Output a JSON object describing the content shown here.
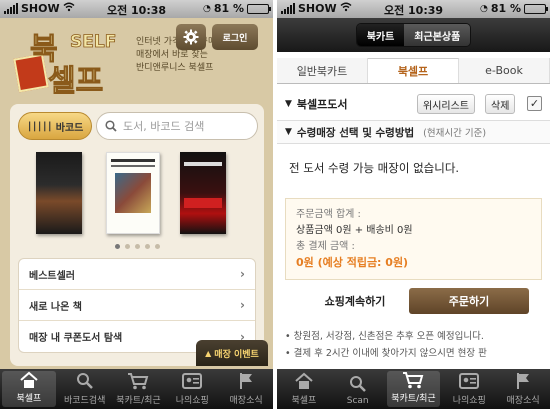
{
  "left": {
    "status": {
      "carrier": "SHOW",
      "time": "오전 10:38",
      "battery": "81 %",
      "battery_level": 0.81
    },
    "logo": {
      "title_1": "북",
      "title_2": "SELF",
      "title_3": "셀프",
      "badge": "book"
    },
    "intro_lines": [
      "인터넷 가격으로 구매하고",
      "매장에서 바로 찾는",
      "반디앤루니스 북셀프"
    ],
    "header": {
      "settings_icon": "gear-icon",
      "login_label": "로그인"
    },
    "barcode_label": "바코드",
    "search": {
      "placeholder": "도서, 바코드 검색"
    },
    "carousel": {
      "page_count": 5,
      "active_index": 0
    },
    "menu": [
      {
        "label": "베스트셀러"
      },
      {
        "label": "새로 나온 책"
      },
      {
        "label": "매장 내 쿠폰도서 탐색"
      }
    ],
    "event_label": "매장 이벤트",
    "tabs": [
      {
        "label": "북셀프",
        "icon": "home-icon",
        "active": true
      },
      {
        "label": "바코드검색",
        "icon": "search-icon",
        "active": false
      },
      {
        "label": "북카트/최근",
        "icon": "cart-icon",
        "active": false
      },
      {
        "label": "나의쇼핑",
        "icon": "id-card-icon",
        "active": false
      },
      {
        "label": "매장소식",
        "icon": "flag-icon",
        "active": false
      }
    ]
  },
  "right": {
    "status": {
      "carrier": "SHOW",
      "time": "오전 10:39",
      "battery": "81 %",
      "battery_level": 0.81
    },
    "segment": [
      {
        "label": "북카트",
        "active": true
      },
      {
        "label": "최근본상품",
        "active": false
      }
    ],
    "top_tabs": [
      {
        "label": "일반북카트",
        "active": false
      },
      {
        "label": "북셀프",
        "active": true
      },
      {
        "label": "e-Book",
        "active": false
      }
    ],
    "shelf": {
      "label": "북셀프도서",
      "wishlist_label": "위시리스트",
      "delete_label": "삭제",
      "check": "✓"
    },
    "pickup": {
      "label": "수령매장 선택 및 수령방법",
      "sub": "(현재시간 기준)"
    },
    "no_store_msg": "전 도서 수령 가능 매장이 없습니다.",
    "order": {
      "total_label": "주문금액 합계 :",
      "total_detail": "상품금액 0원 + 배송비 0원",
      "pay_label": "총 결제 금액 :",
      "pay_amount": "0원 (예상 적립금: 0원)"
    },
    "continue_label": "쇼핑계속하기",
    "order_button": "주문하기",
    "notes": [
      "• 창원점, 서강점, 신촌점은 추후 오픈 예정입니다.",
      "• 결제 후 2시간 이내에 찾아가지 않으시면 현장 판"
    ],
    "tabs": [
      {
        "label": "북셀프",
        "icon": "home-icon",
        "active": false
      },
      {
        "label": "Scan",
        "icon": "search-icon",
        "active": false
      },
      {
        "label": "북카트/최근",
        "icon": "cart-icon",
        "active": true
      },
      {
        "label": "나의쇼핑",
        "icon": "id-card-icon",
        "active": false
      },
      {
        "label": "매장소식",
        "icon": "flag-icon",
        "active": false
      }
    ]
  }
}
